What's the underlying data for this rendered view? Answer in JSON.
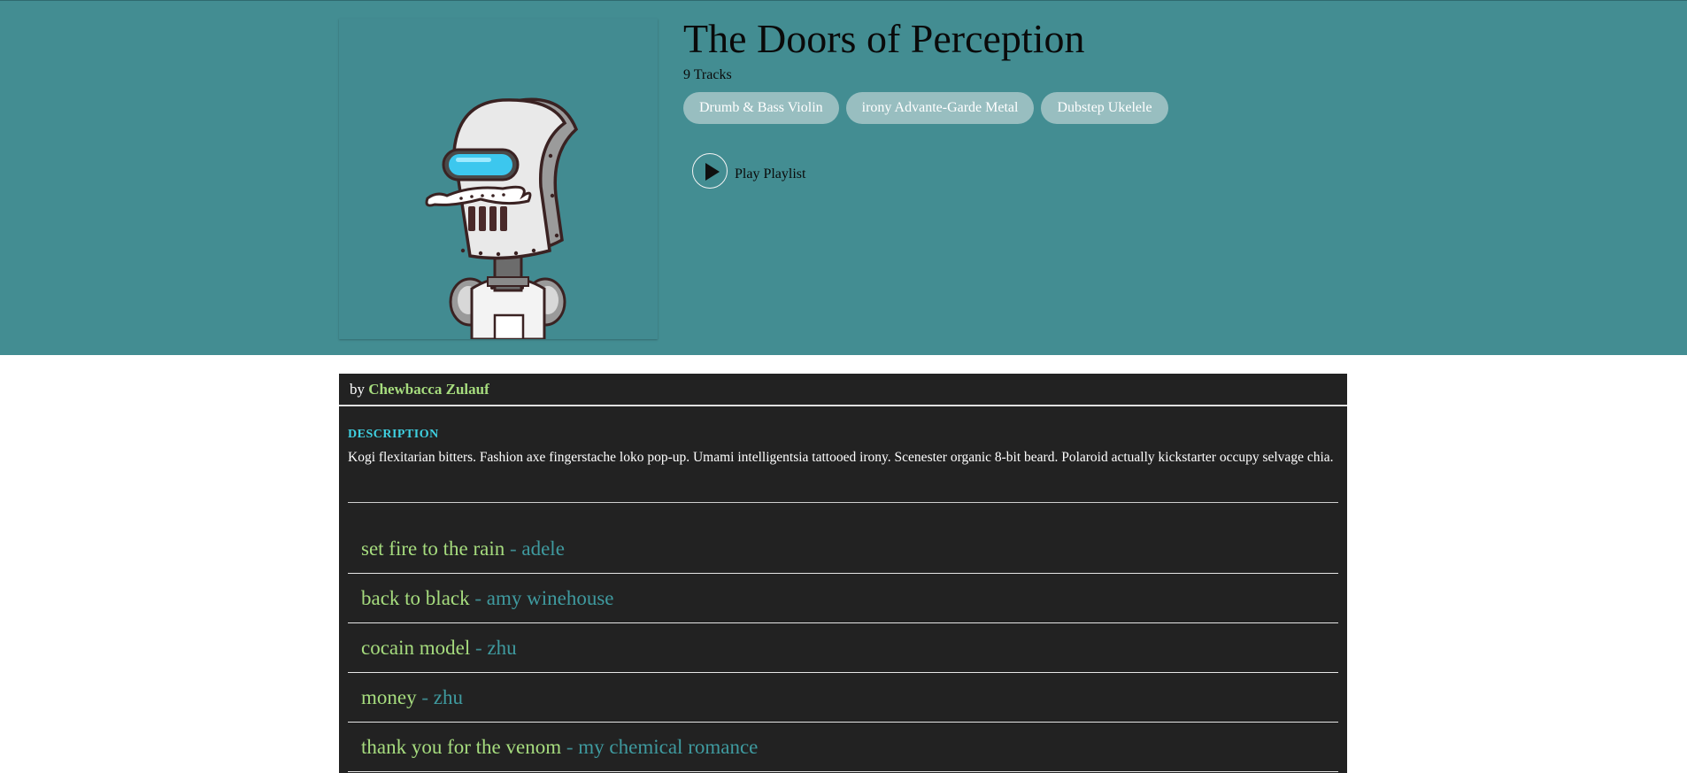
{
  "playlist": {
    "title": "The Doors of Perception",
    "track_count": "9 Tracks",
    "tags": [
      "Drumb & Bass Violin",
      "irony Advante-Garde Metal",
      "Dubstep Ukelele"
    ],
    "play_label": "Play Playlist"
  },
  "details": {
    "by_label": "by",
    "author": "Chewbacca Zulauf",
    "description_heading": "DESCRIPTION",
    "description": "Kogi flexitarian bitters. Fashion axe fingerstache loko pop-up. Umami intelligentsia tattooed irony. Scenester organic 8-bit beard. Polaroid actually kickstarter occupy selvage chia."
  },
  "songs": [
    {
      "name": "set fire to the rain",
      "separator": " - ",
      "artist": "adele"
    },
    {
      "name": "back to black",
      "separator": " - ",
      "artist": "amy winehouse"
    },
    {
      "name": "cocain model",
      "separator": " - ",
      "artist": "zhu"
    },
    {
      "name": "money",
      "separator": " - ",
      "artist": "zhu"
    },
    {
      "name": "thank you for the venom",
      "separator": " - ",
      "artist": "my chemical romance"
    }
  ],
  "icons": {
    "cover": "robot-illustration",
    "play": "play-icon"
  },
  "colors": {
    "hero_background": "#438d92",
    "panel_background": "#222222",
    "song_name": "#a6dc7e",
    "artist_name": "#3f9a9f",
    "description_heading": "#3fd0e0",
    "tag_background": "#98bec0"
  }
}
